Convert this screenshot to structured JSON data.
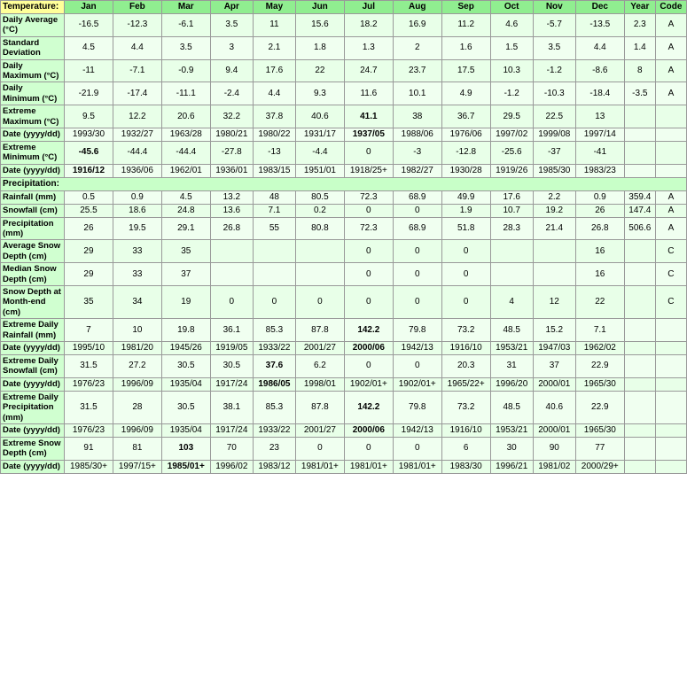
{
  "headers": {
    "col0": "Temperature:",
    "months": [
      "Jan",
      "Feb",
      "Mar",
      "Apr",
      "May",
      "Jun",
      "Jul",
      "Aug",
      "Sep",
      "Oct",
      "Nov",
      "Dec",
      "Year",
      "Code"
    ]
  },
  "rows": [
    {
      "label": "Daily Average (°C)",
      "vals": [
        "-16.5",
        "-12.3",
        "-6.1",
        "3.5",
        "11",
        "15.6",
        "18.2",
        "16.9",
        "11.2",
        "4.6",
        "-5.7",
        "-13.5",
        "2.3",
        "A"
      ],
      "bold": []
    },
    {
      "label": "Standard Deviation",
      "vals": [
        "4.5",
        "4.4",
        "3.5",
        "3",
        "2.1",
        "1.8",
        "1.3",
        "2",
        "1.6",
        "1.5",
        "3.5",
        "4.4",
        "1.4",
        "A"
      ],
      "bold": []
    },
    {
      "label": "Daily Maximum (°C)",
      "vals": [
        "-11",
        "-7.1",
        "-0.9",
        "9.4",
        "17.6",
        "22",
        "24.7",
        "23.7",
        "17.5",
        "10.3",
        "-1.2",
        "-8.6",
        "8",
        "A"
      ],
      "bold": []
    },
    {
      "label": "Daily Minimum (°C)",
      "vals": [
        "-21.9",
        "-17.4",
        "-11.1",
        "-2.4",
        "4.4",
        "9.3",
        "11.6",
        "10.1",
        "4.9",
        "-1.2",
        "-10.3",
        "-18.4",
        "-3.5",
        "A"
      ],
      "bold": []
    },
    {
      "label": "Extreme Maximum (°C)",
      "vals": [
        "9.5",
        "12.2",
        "20.6",
        "32.2",
        "37.8",
        "40.6",
        "41.1",
        "38",
        "36.7",
        "29.5",
        "22.5",
        "13",
        "",
        ""
      ],
      "bold": [
        6
      ]
    },
    {
      "label": "Date (yyyy/dd)",
      "vals": [
        "1993/30",
        "1932/27",
        "1963/28",
        "1980/21",
        "1980/22",
        "1931/17",
        "1937/05",
        "1988/06",
        "1976/06",
        "1997/02",
        "1999/08",
        "1997/14",
        "",
        ""
      ],
      "bold": [
        6
      ]
    },
    {
      "label": "Extreme Minimum (°C)",
      "vals": [
        "-45.6",
        "-44.4",
        "-44.4",
        "-27.8",
        "-13",
        "-4.4",
        "0",
        "-3",
        "-12.8",
        "-25.6",
        "-37",
        "-41",
        "",
        ""
      ],
      "bold": [
        0
      ]
    },
    {
      "label": "Date (yyyy/dd)",
      "vals": [
        "1916/12",
        "1936/06",
        "1962/01",
        "1936/01",
        "1983/15",
        "1951/01",
        "1918/25+",
        "1982/27",
        "1930/28",
        "1919/26",
        "1985/30",
        "1983/23",
        "",
        ""
      ],
      "bold": [
        0
      ]
    },
    {
      "label": "Precipitation:",
      "vals": [
        "",
        "",
        "",
        "",
        "",
        "",
        "",
        "",
        "",
        "",
        "",
        "",
        "",
        ""
      ],
      "section": true,
      "bold": []
    },
    {
      "label": "Rainfall (mm)",
      "vals": [
        "0.5",
        "0.9",
        "4.5",
        "13.2",
        "48",
        "80.5",
        "72.3",
        "68.9",
        "49.9",
        "17.6",
        "2.2",
        "0.9",
        "359.4",
        "A"
      ],
      "bold": []
    },
    {
      "label": "Snowfall (cm)",
      "vals": [
        "25.5",
        "18.6",
        "24.8",
        "13.6",
        "7.1",
        "0.2",
        "0",
        "0",
        "1.9",
        "10.7",
        "19.2",
        "26",
        "147.4",
        "A"
      ],
      "bold": []
    },
    {
      "label": "Precipitation (mm)",
      "vals": [
        "26",
        "19.5",
        "29.1",
        "26.8",
        "55",
        "80.8",
        "72.3",
        "68.9",
        "51.8",
        "28.3",
        "21.4",
        "26.8",
        "506.6",
        "A"
      ],
      "bold": []
    },
    {
      "label": "Average Snow Depth (cm)",
      "vals": [
        "29",
        "33",
        "35",
        "",
        "",
        "",
        "0",
        "0",
        "0",
        "",
        "",
        "16",
        "",
        "C"
      ],
      "bold": []
    },
    {
      "label": "Median Snow Depth (cm)",
      "vals": [
        "29",
        "33",
        "37",
        "",
        "",
        "",
        "0",
        "0",
        "0",
        "",
        "",
        "16",
        "",
        "C"
      ],
      "bold": []
    },
    {
      "label": "Snow Depth at Month-end (cm)",
      "vals": [
        "35",
        "34",
        "19",
        "0",
        "0",
        "0",
        "0",
        "0",
        "0",
        "4",
        "12",
        "22",
        "",
        "C"
      ],
      "bold": []
    },
    {
      "label": "Extreme Daily Rainfall (mm)",
      "vals": [
        "7",
        "10",
        "19.8",
        "36.1",
        "85.3",
        "87.8",
        "142.2",
        "79.8",
        "73.2",
        "48.5",
        "15.2",
        "7.1",
        "",
        ""
      ],
      "bold": [
        6
      ]
    },
    {
      "label": "Date (yyyy/dd)",
      "vals": [
        "1995/10",
        "1981/20",
        "1945/26",
        "1919/05",
        "1933/22",
        "2001/27",
        "2000/06",
        "1942/13",
        "1916/10",
        "1953/21",
        "1947/03",
        "1962/02",
        "",
        ""
      ],
      "bold": [
        6
      ]
    },
    {
      "label": "Extreme Daily Snowfall (cm)",
      "vals": [
        "31.5",
        "27.2",
        "30.5",
        "30.5",
        "37.6",
        "6.2",
        "0",
        "0",
        "20.3",
        "31",
        "37",
        "22.9",
        "",
        ""
      ],
      "bold": [
        4
      ]
    },
    {
      "label": "Date (yyyy/dd)",
      "vals": [
        "1976/23",
        "1996/09",
        "1935/04",
        "1917/24",
        "1986/05",
        "1998/01",
        "1902/01+",
        "1902/01+",
        "1965/22+",
        "1996/20",
        "2000/01",
        "1965/30",
        "",
        ""
      ],
      "bold": [
        4
      ]
    },
    {
      "label": "Extreme Daily Precipitation (mm)",
      "vals": [
        "31.5",
        "28",
        "30.5",
        "38.1",
        "85.3",
        "87.8",
        "142.2",
        "79.8",
        "73.2",
        "48.5",
        "40.6",
        "22.9",
        "",
        ""
      ],
      "bold": [
        6
      ]
    },
    {
      "label": "Date (yyyy/dd)",
      "vals": [
        "1976/23",
        "1996/09",
        "1935/04",
        "1917/24",
        "1933/22",
        "2001/27",
        "2000/06",
        "1942/13",
        "1916/10",
        "1953/21",
        "2000/01",
        "1965/30",
        "",
        ""
      ],
      "bold": [
        6
      ]
    },
    {
      "label": "Extreme Snow Depth (cm)",
      "vals": [
        "91",
        "81",
        "103",
        "70",
        "23",
        "0",
        "0",
        "0",
        "6",
        "30",
        "90",
        "77",
        "",
        ""
      ],
      "bold": [
        2
      ]
    },
    {
      "label": "Date (yyyy/dd)",
      "vals": [
        "1985/30+",
        "1997/15+",
        "1985/01+",
        "1996/02",
        "1983/12",
        "1981/01+",
        "1981/01+",
        "1981/01+",
        "1983/30",
        "1996/21",
        "1981/02",
        "2000/29+",
        "",
        ""
      ],
      "bold": [
        2
      ]
    }
  ]
}
